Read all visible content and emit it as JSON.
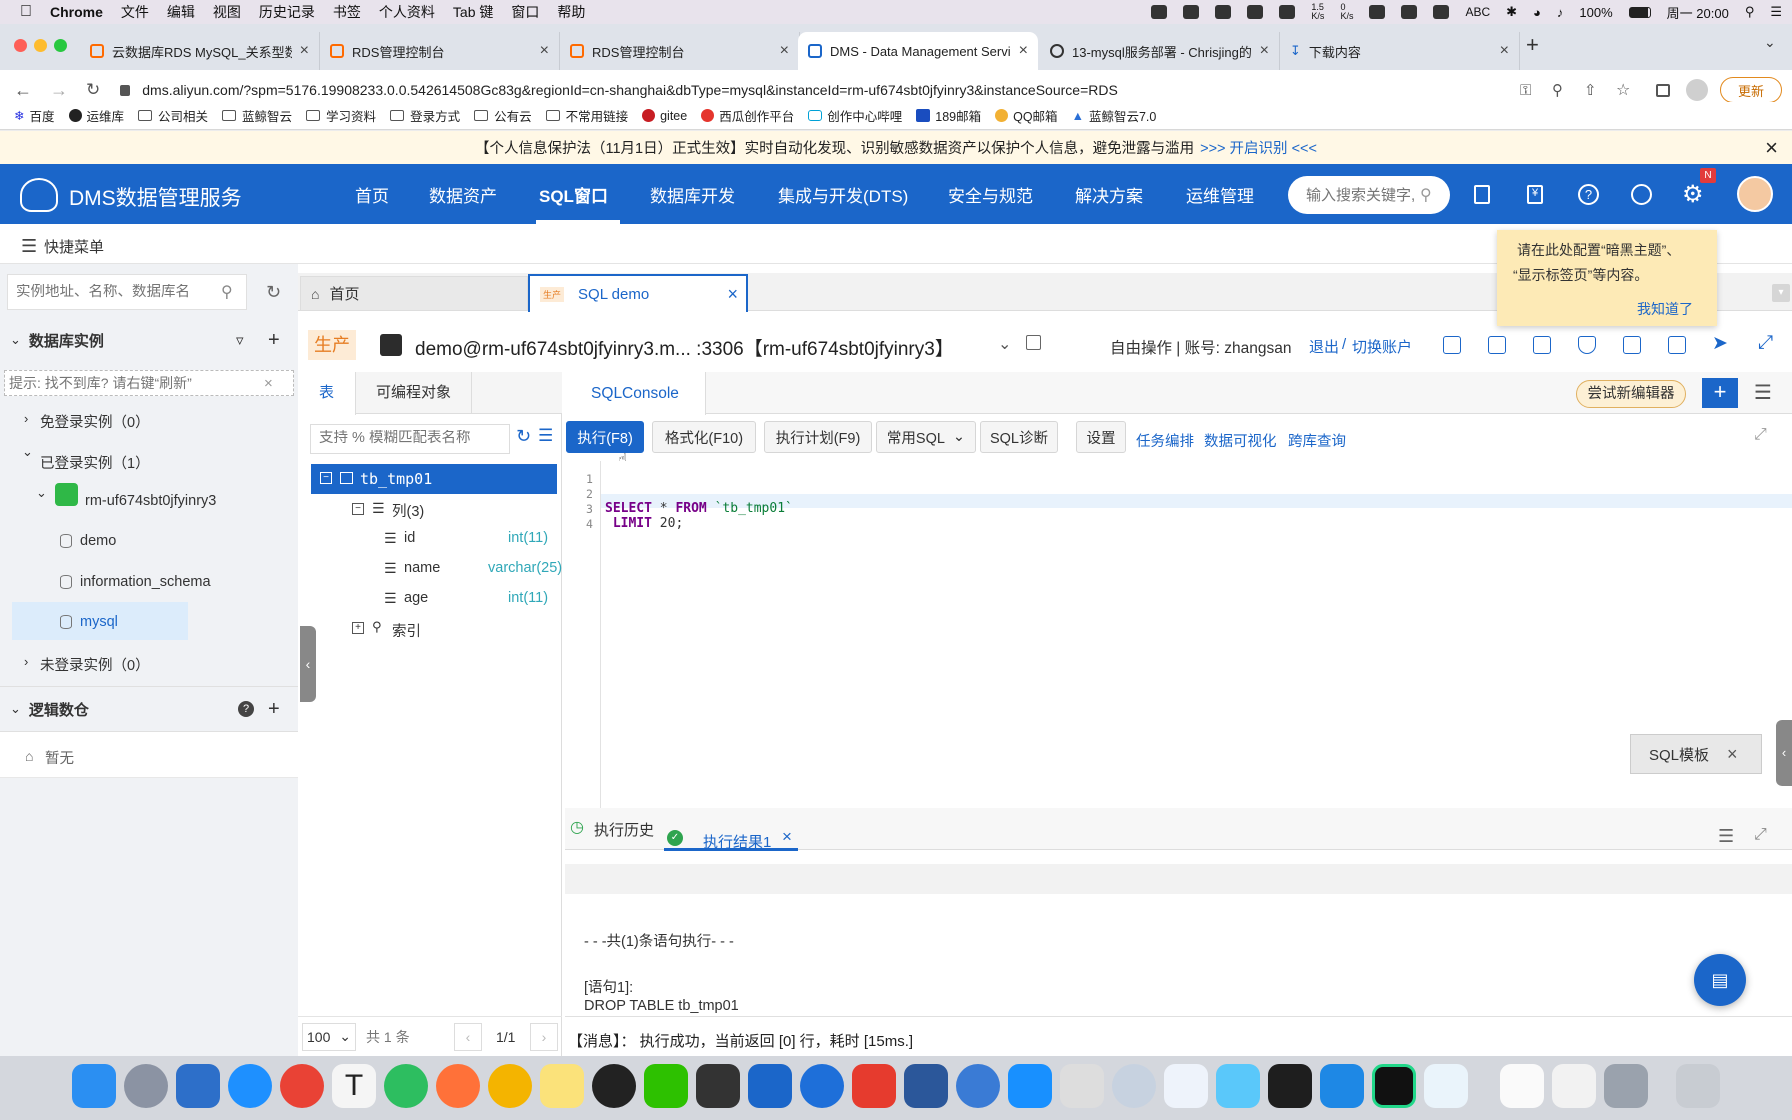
{
  "mac": {
    "app": "Chrome",
    "menus": [
      "文件",
      "编辑",
      "视图",
      "历史记录",
      "书签",
      "个人资料",
      "Tab 键",
      "窗口",
      "帮助"
    ],
    "net_top": "1.5",
    "net_bot": "K/s",
    "net_top2": "0",
    "net_bot2": "K/s",
    "battery": "100%",
    "clock": "周一 20:00",
    "abc": "ABC"
  },
  "browser": {
    "tabs": [
      "云数据库RDS MySQL_关系型数据",
      "RDS管理控制台",
      "RDS管理控制台",
      "DMS - Data Management Servi",
      "13-mysql服务部署 - Chrisjing的",
      "下载内容"
    ],
    "url": "dms.aliyun.com/?spm=5176.19908233.0.0.542614508Gc83g&regionId=cn-shanghai&dbType=mysql&instanceId=rm-uf674sbt0jfyinry3&instanceSource=RDS",
    "update": "更新",
    "bookmarks": [
      "百度",
      "运维库",
      "公司相关",
      "蓝鲸智云",
      "学习资料",
      "登录方式",
      "公有云",
      "不常用链接",
      "gitee",
      "西瓜创作平台",
      "创作中心哔哩",
      "189邮箱",
      "QQ邮箱",
      "蓝鲸智云7.0"
    ]
  },
  "notice": {
    "text": "【个人信息保护法（11月1日）正式生效】实时自动化发现、识别敏感数据资产以保护个人信息，避免泄露与滥用",
    "link": ">>> 开启识别 <<<"
  },
  "nav": {
    "logo": "DMS数据管理服务",
    "items": [
      "首页",
      "数据资产",
      "SQL窗口",
      "数据库开发",
      "集成与开发(DTS)",
      "安全与规范",
      "解决方案",
      "运维管理"
    ],
    "search_ph": "输入搜索关键字,",
    "badge": "N"
  },
  "quick": {
    "label": "快捷菜单"
  },
  "tooltip": {
    "line1": "请在此处配置“暗黑主题”、",
    "line2": "“显示标签页”等内容。",
    "ok": "我知道了"
  },
  "left": {
    "search_ph": "实例地址、名称、数据库名",
    "section": "数据库实例",
    "hint_ph": "提示: 找不到库? 请右键“刷新”",
    "free": "免登录实例（0）",
    "logged": "已登录实例（1）",
    "instance": "rm-uf674sbt0jfyinry3",
    "dbs": [
      "demo",
      "information_schema",
      "mysql"
    ],
    "unlogged": "未登录实例（0）",
    "logic": "逻辑数仓",
    "none": "暂无"
  },
  "ws": {
    "tab_home": "首页",
    "tab_env": "生产",
    "tab_sql": "SQL demo",
    "env": "生产",
    "conn": "demo@rm-uf674sbt0jfyinry3.m... :3306【rm-uf674sbt0jfyinry3】",
    "mode": "自由操作 | 账号: zhangsan",
    "logout": "退出",
    "sep": "/",
    "switch": "切换账户"
  },
  "obj": {
    "tab1": "表",
    "tab2": "可编程对象",
    "search_ph": "支持 % 模糊匹配表名称",
    "table": "tb_tmp01",
    "cols": "列(3)",
    "fields": [
      {
        "n": "id",
        "t": "int(11)"
      },
      {
        "n": "name",
        "t": "varchar(25)"
      },
      {
        "n": "age",
        "t": "int(11)"
      }
    ],
    "idx": "索引",
    "page_size": "100",
    "total": "共 1 条",
    "page": "1/1"
  },
  "console": {
    "tab": "SQLConsole",
    "try": "尝试新编辑器",
    "run": "执行(F8)",
    "fmt": "格式化(F10)",
    "plan": "执行计划(F9)",
    "common": "常用SQL",
    "diag": "SQL诊断",
    "settings": "设置",
    "links": [
      "任务编排",
      "数据可视化",
      "跨库查询"
    ],
    "lines": [
      "1",
      "2",
      "3",
      "4"
    ],
    "kw1": "SELECT",
    "op": " * ",
    "kw2": "FROM",
    "tbl": "`tb_tmp01`",
    "kw3": "LIMIT",
    "num": "20;",
    "tpl": "SQL模板"
  },
  "result": {
    "history": "执行历史",
    "tab": "执行结果1",
    "l1": "- - -共(1)条语句执行- - -",
    "l2": "[语句1]:",
    "l3": "DROP TABLE tb_tmp01",
    "msg": "【消息】： 执行成功，当前返回 [0] 行，耗时 [15ms.]"
  }
}
